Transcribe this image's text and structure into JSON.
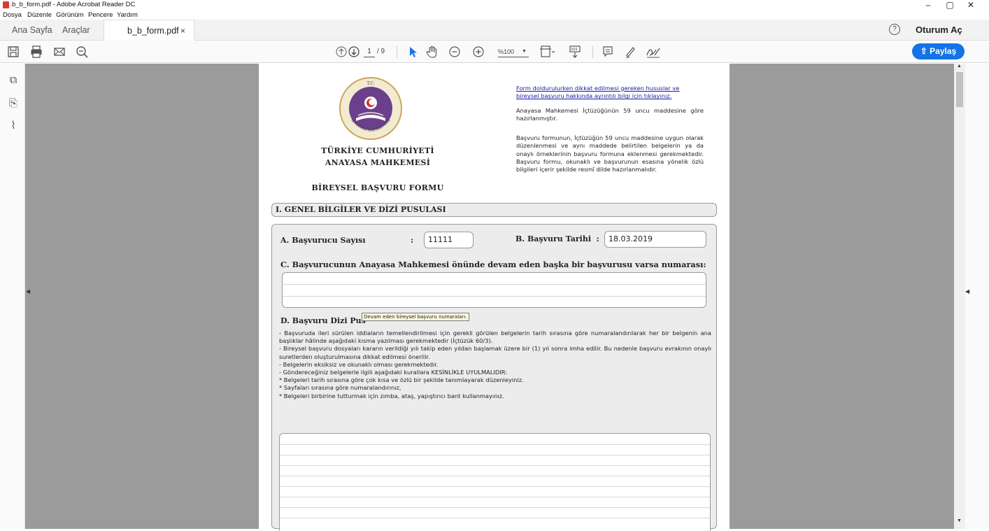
{
  "window": {
    "title": "b_b_form.pdf - Adobe Acrobat Reader DC",
    "controls": {
      "minimize": "–",
      "restore": "▢",
      "close": "✕"
    }
  },
  "menu": [
    "Dosya",
    "Düzenle",
    "Görünüm",
    "Pencere",
    "Yardım"
  ],
  "tabs": {
    "home": "Ana Sayfa",
    "tools": "Araçlar",
    "doc": "b_b_form.pdf",
    "close": "×",
    "login": "Oturum Aç",
    "help": "?"
  },
  "toolbar": {
    "page_current": "1",
    "page_total": "/ 9",
    "zoom": "%100",
    "share": "Paylaş"
  },
  "document": {
    "link_line1": "Form doldurulurken dikkat edilmesi gereken hususlar ve",
    "link_line2": "bireysel başvuru hakkında ayrıntılı bilgi için tıklayınız.",
    "intro1": "Anayasa Mahkemesi İçtüzüğünün 59 uncu maddesine göre hazırlanmıştır.",
    "intro2": "Başvuru formunun, İçtüzüğün 59 uncu maddesine uygun olarak düzenlenmesi ve aynı maddede belirtilen belgelerin ya da onaylı örneklerinin başvuru formuna eklenmesi gerekmektedir. Başvuru formu, okunaklı ve başvurunun esasına yönelik özlü bilgileri içerir şekilde resmî dilde hazırlanmalıdır.",
    "org1": "TÜRKİYE CUMHURİYETİ",
    "org2": "ANAYASA MAHKEMESİ",
    "form_title": "BİREYSEL BAŞVURU FORMU",
    "logo_top": "T.C.",
    "logo_bottom": "ANAYASA MAHKEMESİ",
    "section1": "I. GENEL BİLGİLER VE DİZİ PUSULASI",
    "a_label": "A. Başvurucu Sayısı",
    "colon": ":",
    "a_value": "11111",
    "b_label": "B. Başvuru Tarihi",
    "b_value": "18.03.2019",
    "c_label": "C. Başvurucunun Anayasa Mahkemesi önünde devam eden başka bir başvurusu varsa numarası:",
    "d_label": "D. Başvuru Dizi Pus",
    "tooltip": "Devam eden bireysel başvuru numaraları.",
    "instructions": [
      "- Başvuruda ileri sürülen iddiaların temellendirilmesi için gerekli görülen belgelerin tarih sırasına göre numaralandırılarak her bir belgenin ana başlıklar hâlinde aşağıdaki kısma yazılması gerekmektedir (İçtüzük 60/3).",
      "- Bireysel başvuru dosyaları kararın verildiği yılı takip eden yıldan başlamak üzere bir (1) yıl sonra imha edilir. Bu nedenle başvuru evrakının onaylı suretlerden oluşturulmasına dikkat edilmesi önerilir.",
      "- Belgelerin eksiksiz ve okunaklı olması gerekmektedir.",
      "- Göndereceğiniz belgelerle ilgili aşağıdaki kurallara KESİNLİKLE UYULMALIDIR:",
      "* Belgeleri tarih sırasına göre çok kısa ve özlü bir şekilde tanımlayarak düzenleyiniz.",
      "* Sayfaları sırasına göre numaralandırınız,",
      "* Belgeleri birbirine tutturmak için zımba, ataş, yapıştırıcı bant kullanmayınız."
    ]
  },
  "colors": {
    "accent": "#1473e6",
    "viewer_bg": "#9b9b9b",
    "logo_purple": "#6c3f8c",
    "logo_gold": "#c9a95a"
  }
}
